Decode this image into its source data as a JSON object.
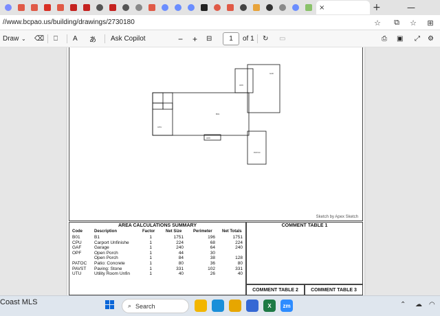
{
  "browser": {
    "tab_favicons": [
      {
        "name": "tab-icon-1",
        "color": "#7b8cff",
        "round": true
      },
      {
        "name": "tab-icon-2",
        "color": "#e05a47",
        "round": false
      },
      {
        "name": "tab-icon-3",
        "color": "#e05a47",
        "round": false
      },
      {
        "name": "tab-icon-4",
        "color": "#d93025",
        "round": false
      },
      {
        "name": "tab-icon-5",
        "color": "#e05a47",
        "round": false
      },
      {
        "name": "tab-icon-6",
        "color": "#c5221f",
        "round": false
      },
      {
        "name": "tab-icon-7",
        "color": "#c5221f",
        "round": false
      },
      {
        "name": "tab-icon-8",
        "color": "#555555",
        "round": true
      },
      {
        "name": "tab-icon-9",
        "color": "#c5221f",
        "round": false
      },
      {
        "name": "tab-icon-10",
        "color": "#555555",
        "round": true
      },
      {
        "name": "tab-icon-11",
        "color": "#888888",
        "round": true
      },
      {
        "name": "tab-icon-12",
        "color": "#e05a47",
        "round": false
      },
      {
        "name": "tab-icon-13",
        "color": "#6a8dff",
        "round": true
      },
      {
        "name": "tab-icon-14",
        "color": "#6a8dff",
        "round": true
      },
      {
        "name": "tab-icon-15",
        "color": "#6a8dff",
        "round": true
      },
      {
        "name": "tab-icon-16",
        "color": "#222222",
        "round": false
      },
      {
        "name": "tab-icon-17",
        "color": "#e05a47",
        "round": true
      },
      {
        "name": "tab-icon-18",
        "color": "#e05a47",
        "round": false
      },
      {
        "name": "tab-icon-19",
        "color": "#444444",
        "round": true
      },
      {
        "name": "tab-icon-20",
        "color": "#e8a33a",
        "round": false
      },
      {
        "name": "tab-icon-21",
        "color": "#333333",
        "round": true
      },
      {
        "name": "tab-icon-22",
        "color": "#8a8a8a",
        "round": true
      },
      {
        "name": "tab-icon-23",
        "color": "#6a8dff",
        "round": true
      },
      {
        "name": "tab-icon-24",
        "color": "#8ac26a",
        "round": false
      }
    ],
    "active_tab_close": "×",
    "new_tab": "+",
    "url": "//www.bcpao.us/building/drawings/2730180"
  },
  "pdf_toolbar": {
    "draw_label": "Draw",
    "ask_copilot": "Ask Copilot",
    "zoom_out": "−",
    "zoom_in": "+",
    "page_current": "1",
    "page_total": "of 1"
  },
  "sketch": {
    "credit": "Sketch by Apex Sketch"
  },
  "area_table": {
    "title": "AREA CALCULATIONS SUMMARY",
    "headers": {
      "code": "Code",
      "description": "Description",
      "factor": "Factor",
      "net_size": "Net Size",
      "perimeter": "Perimeter",
      "net_totals": "Net Totals"
    },
    "rows": [
      {
        "code": "B01",
        "description": "B1",
        "factor": "1",
        "net_size": "1751",
        "perimeter": "196",
        "net_totals": "1751"
      },
      {
        "code": "CPU",
        "description": "Carport Unfinishe",
        "factor": "1",
        "net_size": "224",
        "perimeter": "68",
        "net_totals": "224"
      },
      {
        "code": "GAF",
        "description": "Garage",
        "factor": "1",
        "net_size": "240",
        "perimeter": "64",
        "net_totals": "240"
      },
      {
        "code": "OPF",
        "description": "Open Porch",
        "factor": "1",
        "net_size": "44",
        "perimeter": "30",
        "net_totals": ""
      },
      {
        "code": "",
        "description": "Open Porch",
        "factor": "1",
        "net_size": "84",
        "perimeter": "38",
        "net_totals": "128"
      },
      {
        "code": "PATOC",
        "description": "Patio: Concrete",
        "factor": "1",
        "net_size": "80",
        "perimeter": "36",
        "net_totals": "80"
      },
      {
        "code": "PAVST",
        "description": "Paving: Stone",
        "factor": "1",
        "net_size": "331",
        "perimeter": "102",
        "net_totals": "331"
      },
      {
        "code": "UTU",
        "description": "Utility Room Unfin",
        "factor": "1",
        "net_size": "40",
        "perimeter": "26",
        "net_totals": "40"
      }
    ]
  },
  "comment_tables": {
    "table1": "COMMENT TABLE 1",
    "table2": "COMMENT TABLE 2",
    "table3": "COMMENT TABLE 3"
  },
  "taskbar": {
    "left_label": "Coast MLS",
    "search_placeholder": "Search",
    "apps": [
      {
        "name": "taskbar-app-explorer",
        "color": "#f2b600",
        "glyph": ""
      },
      {
        "name": "taskbar-app-edge",
        "color": "#1a8fd9",
        "glyph": ""
      },
      {
        "name": "taskbar-app-files",
        "color": "#e7a600",
        "glyph": ""
      },
      {
        "name": "taskbar-app-store",
        "color": "#3568d4",
        "glyph": ""
      },
      {
        "name": "taskbar-app-excel",
        "color": "#1e7a45",
        "glyph": "X"
      },
      {
        "name": "taskbar-app-zoom",
        "color": "#2d8cff",
        "glyph": "zm"
      }
    ]
  }
}
